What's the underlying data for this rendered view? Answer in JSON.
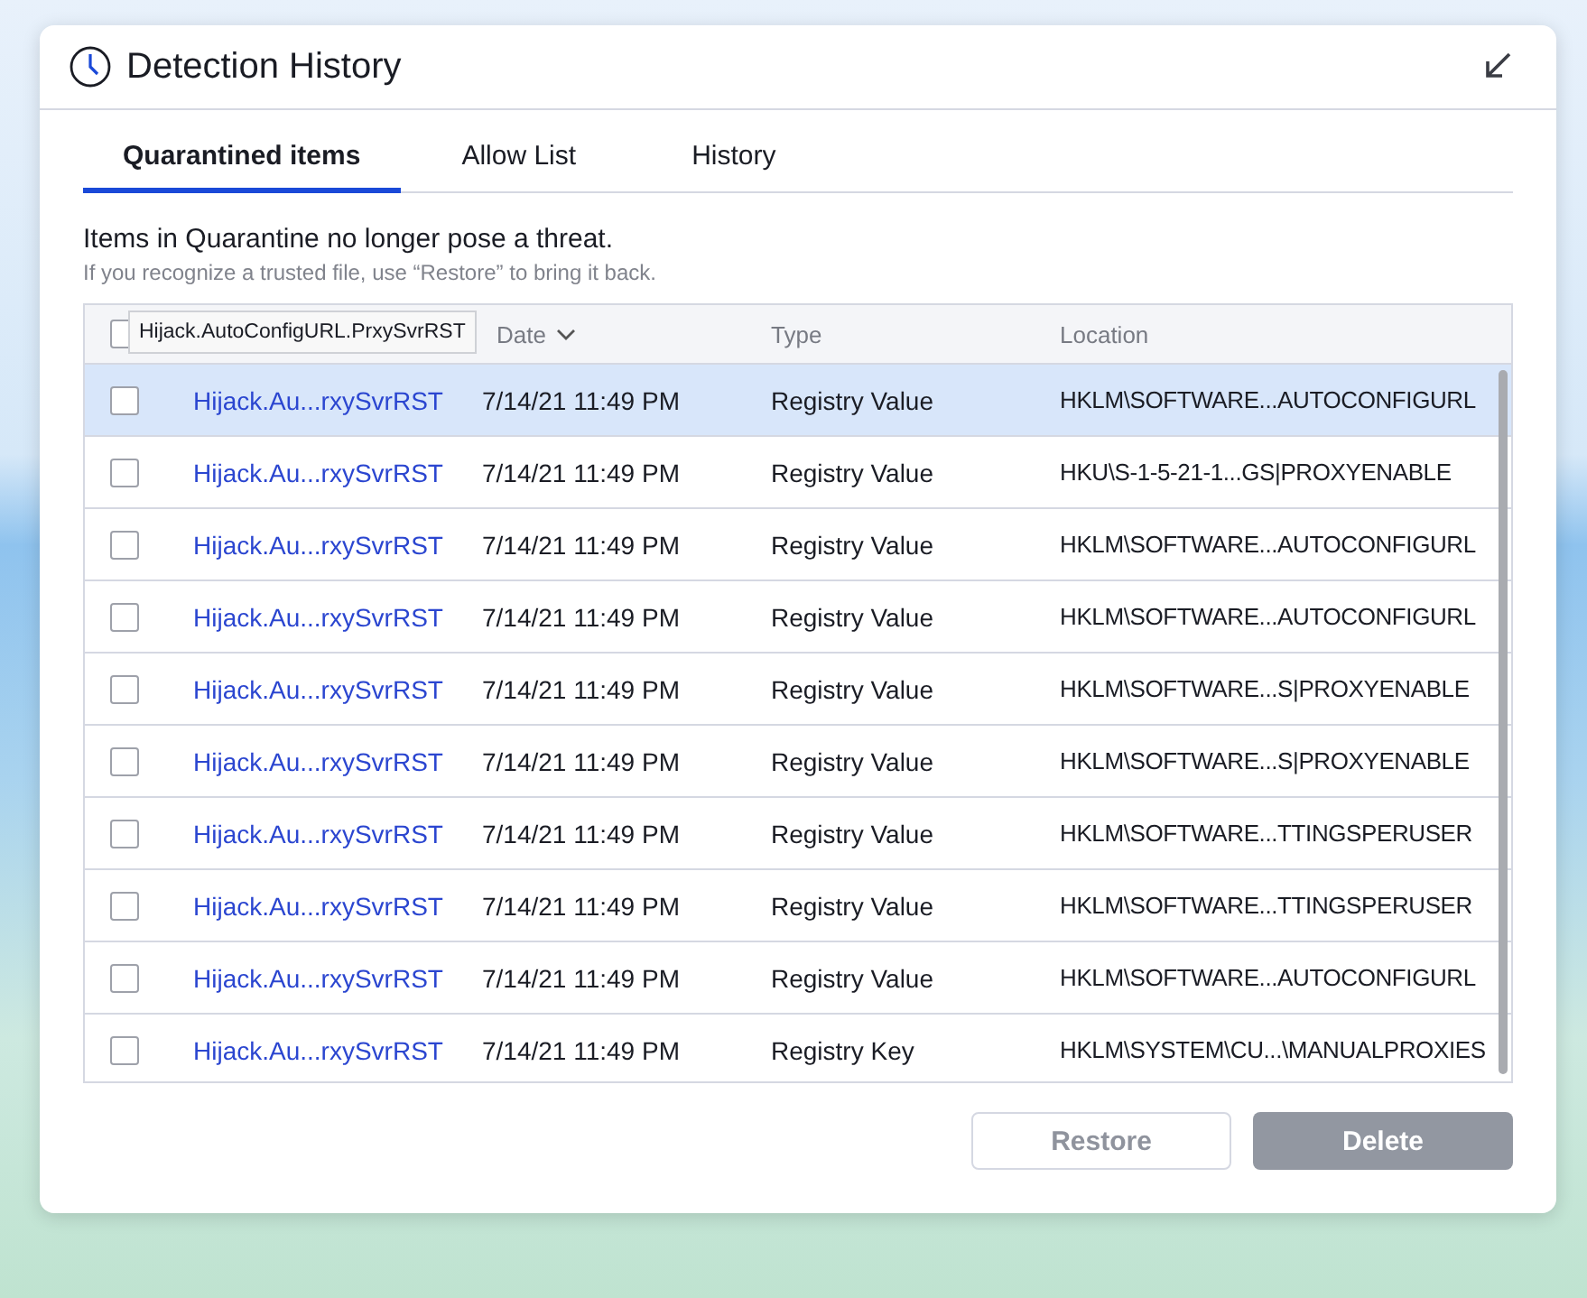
{
  "dialog": {
    "title": "Detection History"
  },
  "tabs": [
    {
      "label": "Quarantined items",
      "selected": true
    },
    {
      "label": "Allow List",
      "selected": false
    },
    {
      "label": "History",
      "selected": false
    }
  ],
  "intro": {
    "heading": "Items in Quarantine no longer pose a threat.",
    "hint": "If you recognize a trusted file, use “Restore” to bring it back."
  },
  "table": {
    "select_all": {
      "checked": false
    },
    "tooltip": "Hijack.AutoConfigURL.PrxySvrRST",
    "columns": [
      {
        "label": "Date",
        "sorted": true
      },
      {
        "label": "Type",
        "sorted": false
      },
      {
        "label": "Location",
        "sorted": false
      }
    ],
    "rows": [
      {
        "name": "Hijack.Au...rxySvrRST",
        "date": "7/14/21 11:49 PM",
        "type": "Registry Value",
        "location": "HKLM\\SOFTWARE...AUTOCONFIGURL",
        "checked": false,
        "selected": true
      },
      {
        "name": "Hijack.Au...rxySvrRST",
        "date": "7/14/21 11:49 PM",
        "type": "Registry Value",
        "location": "HKU\\S-1-5-21-1...GS|PROXYENABLE",
        "checked": false,
        "selected": false
      },
      {
        "name": "Hijack.Au...rxySvrRST",
        "date": "7/14/21 11:49 PM",
        "type": "Registry Value",
        "location": "HKLM\\SOFTWARE...AUTOCONFIGURL",
        "checked": false,
        "selected": false
      },
      {
        "name": "Hijack.Au...rxySvrRST",
        "date": "7/14/21 11:49 PM",
        "type": "Registry Value",
        "location": "HKLM\\SOFTWARE...AUTOCONFIGURL",
        "checked": false,
        "selected": false
      },
      {
        "name": "Hijack.Au...rxySvrRST",
        "date": "7/14/21 11:49 PM",
        "type": "Registry Value",
        "location": "HKLM\\SOFTWARE...S|PROXYENABLE",
        "checked": false,
        "selected": false
      },
      {
        "name": "Hijack.Au...rxySvrRST",
        "date": "7/14/21 11:49 PM",
        "type": "Registry Value",
        "location": "HKLM\\SOFTWARE...S|PROXYENABLE",
        "checked": false,
        "selected": false
      },
      {
        "name": "Hijack.Au...rxySvrRST",
        "date": "7/14/21 11:49 PM",
        "type": "Registry Value",
        "location": "HKLM\\SOFTWARE...TTINGSPERUSER",
        "checked": false,
        "selected": false
      },
      {
        "name": "Hijack.Au...rxySvrRST",
        "date": "7/14/21 11:49 PM",
        "type": "Registry Value",
        "location": "HKLM\\SOFTWARE...TTINGSPERUSER",
        "checked": false,
        "selected": false
      },
      {
        "name": "Hijack.Au...rxySvrRST",
        "date": "7/14/21 11:49 PM",
        "type": "Registry Value",
        "location": "HKLM\\SOFTWARE...AUTOCONFIGURL",
        "checked": false,
        "selected": false
      },
      {
        "name": "Hijack.Au...rxySvrRST",
        "date": "7/14/21 11:49 PM",
        "type": "Registry Key",
        "location": "HKLM\\SYSTEM\\CU...\\MANUALPROXIES",
        "checked": false,
        "selected": false
      }
    ]
  },
  "buttons": [
    {
      "label": "Restore",
      "kind": "outline",
      "disabled": true
    },
    {
      "label": "Delete",
      "kind": "filled",
      "disabled": true
    }
  ]
}
